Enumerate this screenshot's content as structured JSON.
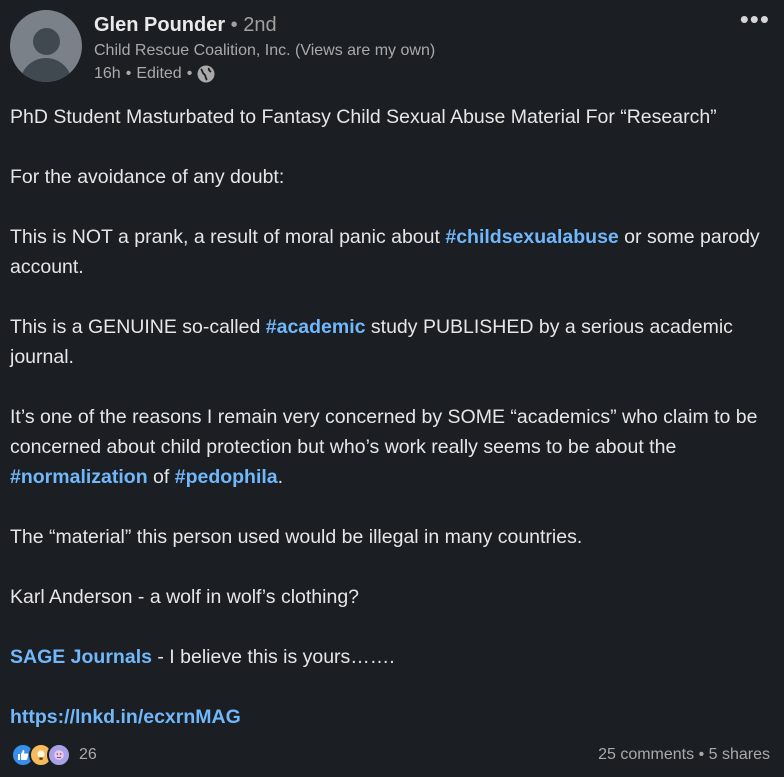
{
  "author": {
    "name": "Glen Pounder",
    "degree_sep": " • ",
    "degree": "2nd",
    "headline": "Child Rescue Coalition, Inc. (Views are my own)",
    "time": "16h",
    "edited": "Edited",
    "visibility_icon": "globe-icon"
  },
  "menu": {
    "more_label": "•••"
  },
  "post": {
    "p1": "PhD Student Masturbated to Fantasy Child Sexual Abuse Material For “Research”",
    "p2": "For the avoidance of any doubt:",
    "p3": {
      "pre": "This is NOT a prank, a result of moral panic about ",
      "tag": "#childsexualabuse",
      "post": " or some parody account."
    },
    "p4": {
      "pre": "This is a GENUINE so-called ",
      "tag": "#academic",
      "post": " study PUBLISHED by a serious academic journal."
    },
    "p5": {
      "pre": "It’s one of the reasons I remain very concerned by SOME “academics” who claim to be concerned about child protection but who’s work really seems to be about the ",
      "tag1": "#normalization",
      "mid": " of ",
      "tag2": "#pedophila",
      "post": "."
    },
    "p6": "The “material” this person used would be illegal in many countries.",
    "p7": "Karl Anderson - a wolf in wolf’s clothing?",
    "p8": {
      "mention": "SAGE Journals",
      "post": " - I believe this is yours……."
    },
    "p9": {
      "link": "https://lnkd.in/ecxrnMAG"
    }
  },
  "footer": {
    "reaction_icons": [
      "like-icon",
      "insightful-icon",
      "curious-icon"
    ],
    "reaction_count": "26",
    "comments": "25 comments",
    "sep": " • ",
    "shares": "5 shares"
  },
  "colors": {
    "background": "#1b1f23",
    "link": "#71b7fb",
    "text": "#e6e6e6",
    "muted": "#a9a9a9"
  }
}
